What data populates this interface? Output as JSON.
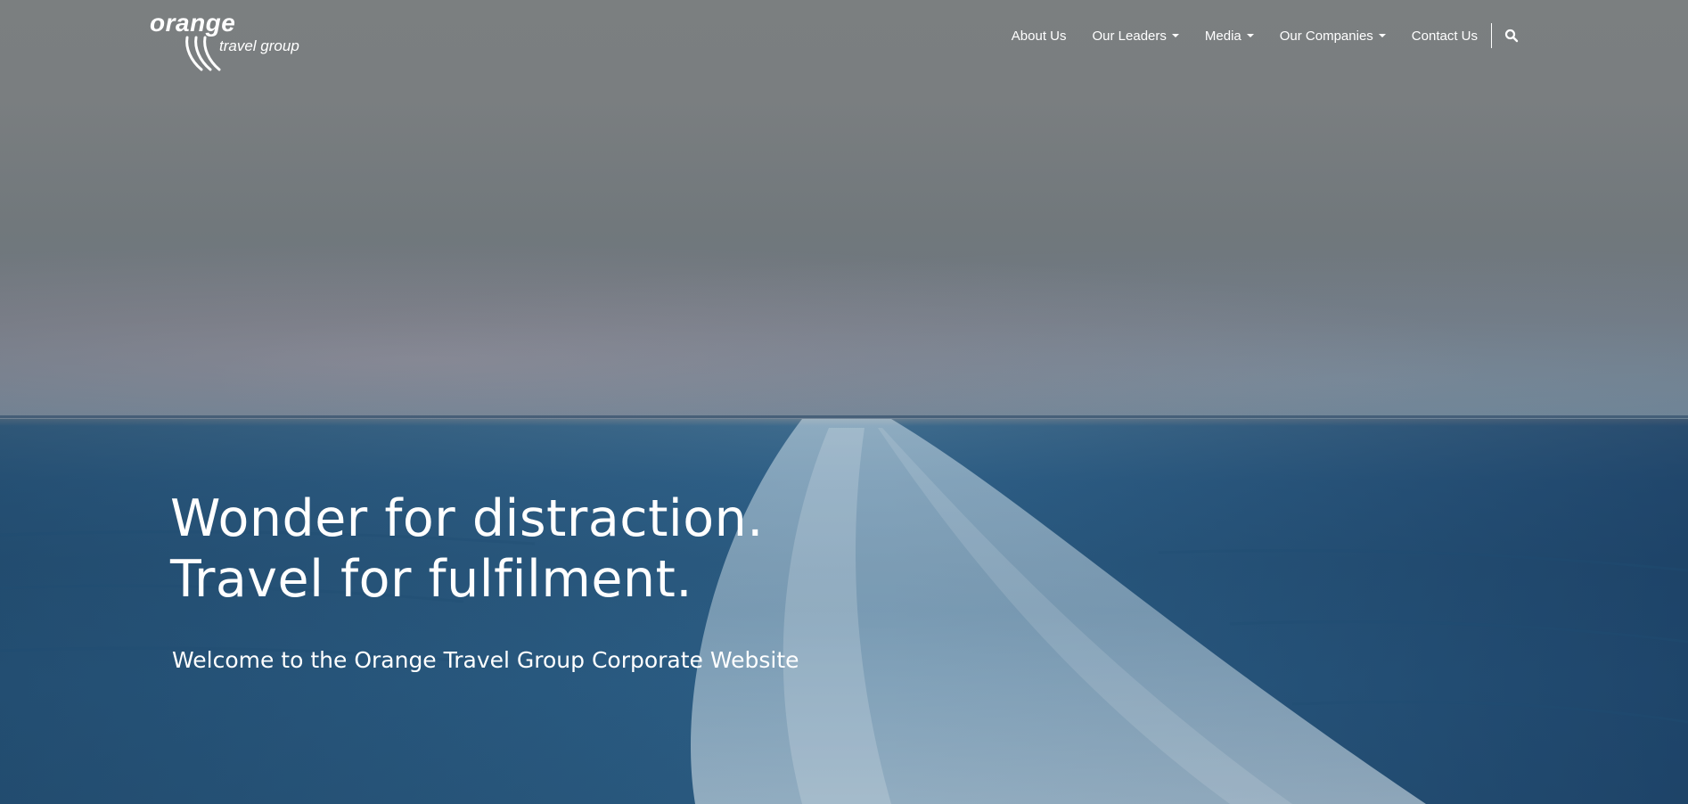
{
  "logo": {
    "word": "orange",
    "sub": "travel group"
  },
  "nav": {
    "items": [
      {
        "label": "About Us",
        "dropdown": false
      },
      {
        "label": "Our Leaders",
        "dropdown": true
      },
      {
        "label": "Media",
        "dropdown": true
      },
      {
        "label": "Our Companies",
        "dropdown": true
      },
      {
        "label": "Contact Us",
        "dropdown": false
      }
    ],
    "search_icon": "search-icon"
  },
  "hero": {
    "headline_line1": "Wonder for distraction.",
    "headline_line2": "Travel for fulfilment.",
    "subheadline": "Welcome to the Orange Travel Group Corporate Website"
  },
  "colors": {
    "text": "#ffffff",
    "sky": "#7b7f80",
    "sea": "#2a5a80"
  }
}
